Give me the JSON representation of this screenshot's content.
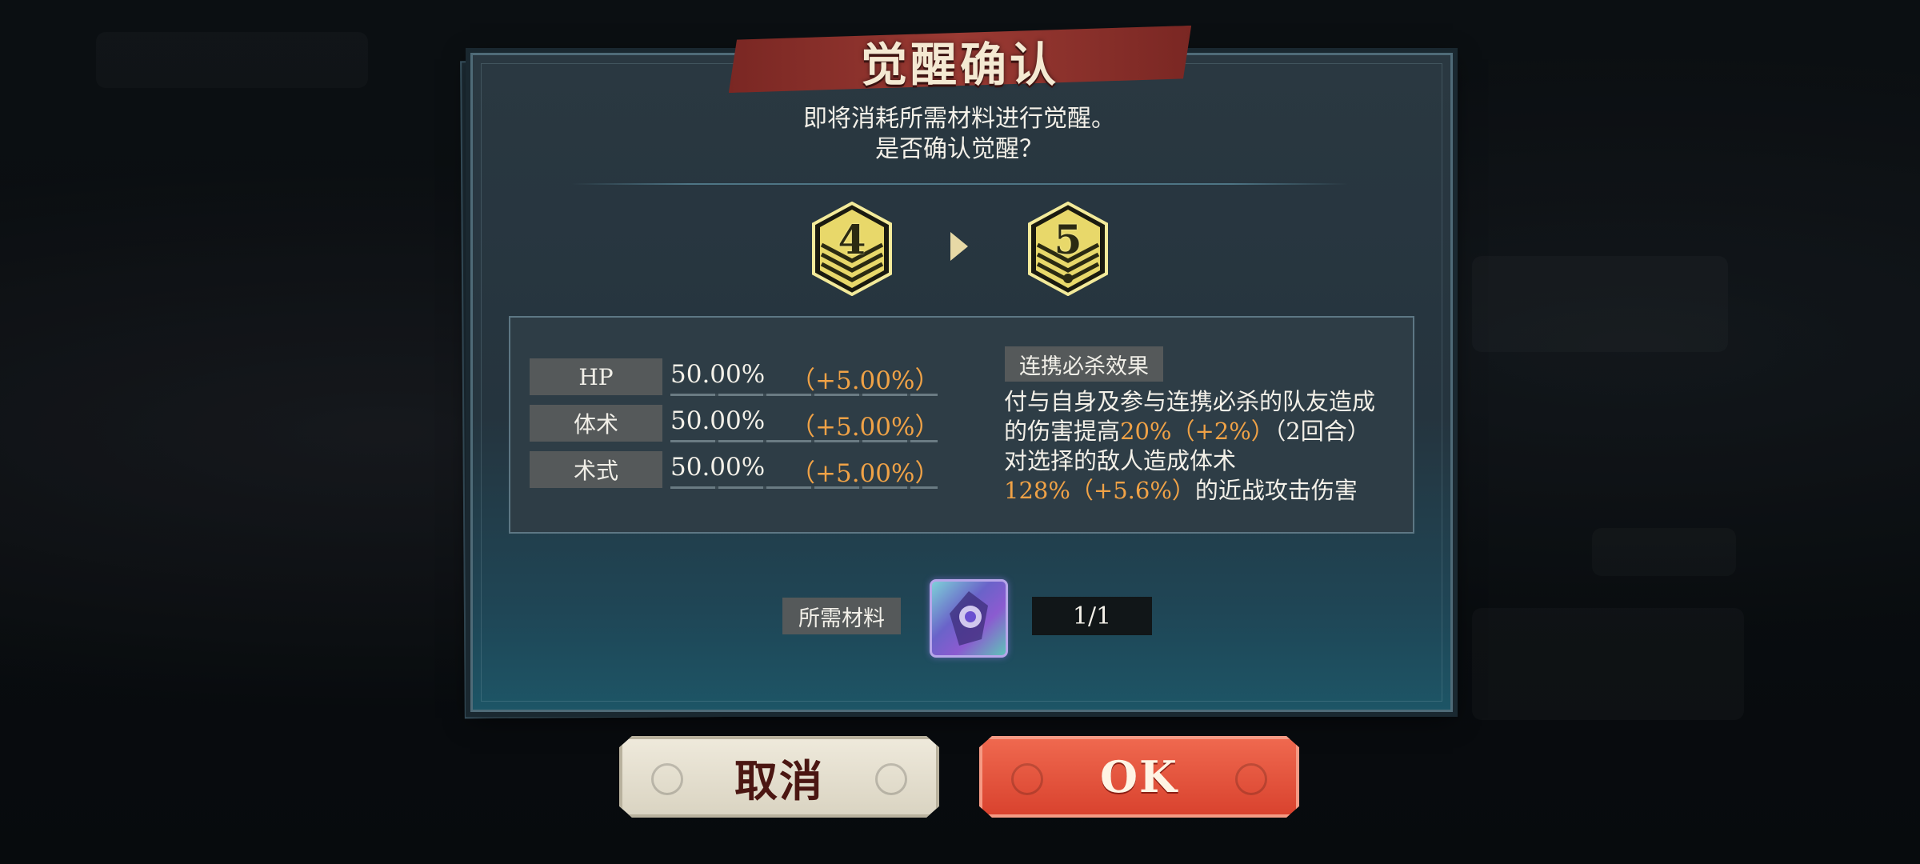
{
  "dialog": {
    "title": "觉醒确认",
    "message_line1": "即将消耗所需材料进行觉醒。",
    "message_line2": "是否确认觉醒？"
  },
  "rank": {
    "from": "4",
    "to": "5"
  },
  "stats": [
    {
      "label": "HP",
      "value": "50.00%",
      "bonus": "（+5.00%）"
    },
    {
      "label": "体术",
      "value": "50.00%",
      "bonus": "（+5.00%）"
    },
    {
      "label": "术式",
      "value": "50.00%",
      "bonus": "（+5.00%）"
    }
  ],
  "skill": {
    "tag": "连携必杀效果",
    "line1": "付与自身及参与连携必杀的队友造成",
    "line2_a": "的伤害提高",
    "line2_b": "20%（+2%）",
    "line2_c": "（2回合）",
    "line3": "对选择的敌人造成体术",
    "line4_a": "128%（+5.6%）",
    "line4_b": "的近战攻击伤害"
  },
  "materials": {
    "label": "所需材料",
    "count": "1/1",
    "icon": "awakening-crystal-icon"
  },
  "buttons": {
    "cancel": "取消",
    "ok": "OK"
  },
  "colors": {
    "title_banner": "#9a3a33",
    "highlight": "#f0a246",
    "ok_button": "#e0503a",
    "cancel_button": "#e6e0cf",
    "badge_gold": "#e8d86a"
  }
}
